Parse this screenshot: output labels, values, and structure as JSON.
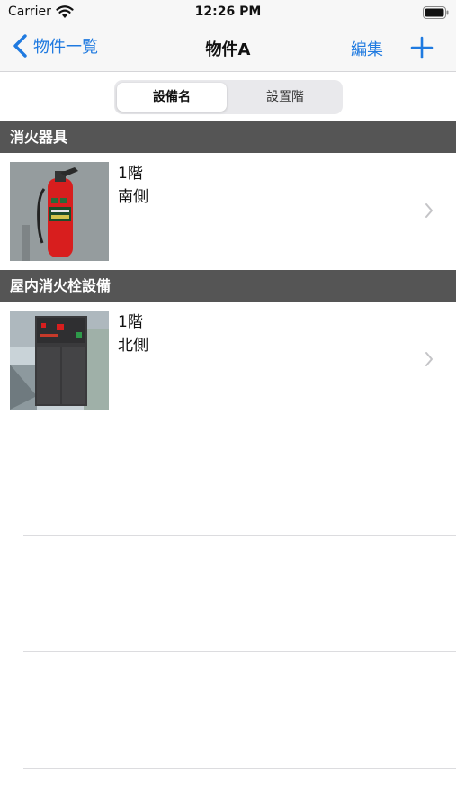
{
  "status_bar": {
    "carrier": "Carrier",
    "time": "12:26 PM"
  },
  "nav": {
    "back_label": "物件一覧",
    "title": "物件A",
    "edit_label": "編集"
  },
  "segment": {
    "active_label": "設備名",
    "inactive_label": "設置階"
  },
  "sections": [
    {
      "header": "消火器具",
      "row": {
        "floor": "1階",
        "location": "南側",
        "image": "fire-extinguisher-photo"
      }
    },
    {
      "header": "屋内消火栓設備",
      "row": {
        "floor": "1階",
        "location": "北側",
        "image": "fire-hydrant-cabinet-photo"
      }
    }
  ],
  "colors": {
    "accent": "#1f7ae0",
    "section_header": "#555555",
    "extinguisher_red": "#d81e1e"
  }
}
